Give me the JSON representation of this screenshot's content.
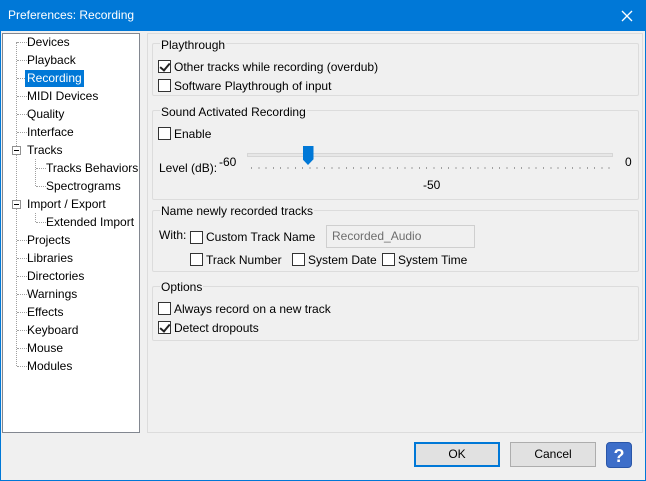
{
  "window": {
    "title": "Preferences: Recording"
  },
  "tree": {
    "items": [
      {
        "label": "Devices",
        "level": 0,
        "selected": false
      },
      {
        "label": "Playback",
        "level": 0,
        "selected": false
      },
      {
        "label": "Recording",
        "level": 0,
        "selected": true
      },
      {
        "label": "MIDI Devices",
        "level": 0,
        "selected": false
      },
      {
        "label": "Quality",
        "level": 0,
        "selected": false
      },
      {
        "label": "Interface",
        "level": 0,
        "selected": false
      },
      {
        "label": "Tracks",
        "level": 0,
        "selected": false,
        "expanded": true
      },
      {
        "label": "Tracks Behaviors",
        "level": 1,
        "selected": false
      },
      {
        "label": "Spectrograms",
        "level": 1,
        "selected": false
      },
      {
        "label": "Import / Export",
        "level": 0,
        "selected": false,
        "expanded": true
      },
      {
        "label": "Extended Import",
        "level": 1,
        "selected": false
      },
      {
        "label": "Projects",
        "level": 0,
        "selected": false
      },
      {
        "label": "Libraries",
        "level": 0,
        "selected": false
      },
      {
        "label": "Directories",
        "level": 0,
        "selected": false
      },
      {
        "label": "Warnings",
        "level": 0,
        "selected": false
      },
      {
        "label": "Effects",
        "level": 0,
        "selected": false
      },
      {
        "label": "Keyboard",
        "level": 0,
        "selected": false
      },
      {
        "label": "Mouse",
        "level": 0,
        "selected": false
      },
      {
        "label": "Modules",
        "level": 0,
        "selected": false
      }
    ]
  },
  "playthrough": {
    "heading": "Playthrough",
    "other_tracks": {
      "label": "Other tracks while recording (overdub)",
      "checked": true
    },
    "software_playthrough": {
      "label": "Software Playthrough of input",
      "checked": false
    }
  },
  "sound_activated": {
    "heading": "Sound Activated Recording",
    "enable": {
      "label": "Enable",
      "checked": false
    },
    "level_label": "Level (dB):",
    "min_label": "-60",
    "max_label": "0",
    "value_label": "-50",
    "min": -60,
    "max": 0,
    "value": -50
  },
  "naming": {
    "heading": "Name newly recorded tracks",
    "with_label": "With:",
    "custom_track_name": {
      "label": "Custom Track Name",
      "checked": false
    },
    "name_value": "Recorded_Audio",
    "track_number": {
      "label": "Track Number",
      "checked": false
    },
    "system_date": {
      "label": "System Date",
      "checked": false
    },
    "system_time": {
      "label": "System Time",
      "checked": false
    }
  },
  "options": {
    "heading": "Options",
    "always_new_track": {
      "label": "Always record on a new track",
      "checked": false
    },
    "detect_dropouts": {
      "label": "Detect dropouts",
      "checked": true
    }
  },
  "buttons": {
    "ok": "OK",
    "cancel": "Cancel",
    "help": "?"
  }
}
